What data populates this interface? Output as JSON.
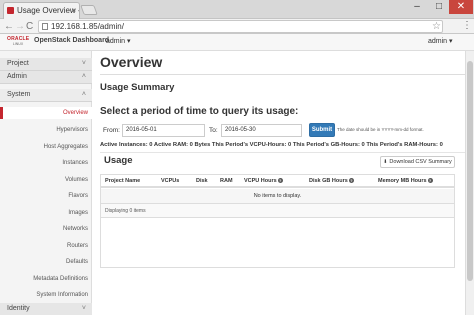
{
  "browser": {
    "tab_title": "Usage Overview - Ol",
    "tab_close": "×",
    "url": "192.168.1.85/admin/",
    "window_min": "–",
    "window_max": "□",
    "window_close": "✕",
    "back": "←",
    "forward": "→",
    "reload": "C",
    "star": "☆",
    "menu": "⋮"
  },
  "header": {
    "logo_text": "ORACLE",
    "logo_sub": "LINUX",
    "dashboard_name": "OpenStack Dashboard",
    "project_selector": "admin ▾",
    "user_selector": "admin ▾"
  },
  "sidebar": {
    "panels": {
      "project": "Project",
      "admin": "Admin",
      "system": "System",
      "identity": "Identity"
    },
    "items": [
      "Overview",
      "Hypervisors",
      "Host Aggregates",
      "Instances",
      "Volumes",
      "Flavors",
      "Images",
      "Networks",
      "Routers",
      "Defaults",
      "Metadata Definitions",
      "System Information"
    ]
  },
  "main": {
    "title": "Overview",
    "subtitle": "Usage Summary",
    "query_heading": "Select a period of time to query its usage:",
    "from_label": "From:",
    "from_value": "2016-05-01",
    "to_label": "To:",
    "to_value": "2016-05-30",
    "submit_label": "Submit",
    "date_hint": "The date should be in YYYY-mm-dd format.",
    "stats_line": "Active Instances: 0 Active RAM: 0 Bytes This Period's VCPU-Hours: 0 This Period's GB-Hours: 0 This Period's RAM-Hours: 0",
    "usage_title": "Usage",
    "csv_button": "Download CSV Summary",
    "table": {
      "columns": [
        "Project Name",
        "VCPUs",
        "Disk",
        "RAM",
        "VCPU Hours",
        "Disk GB Hours",
        "Memory MB Hours"
      ],
      "empty_text": "No items to display.",
      "footer": "Displaying 0 items"
    }
  },
  "colors": {
    "accent_red": "#c4262e",
    "primary_blue": "#337ab7"
  }
}
